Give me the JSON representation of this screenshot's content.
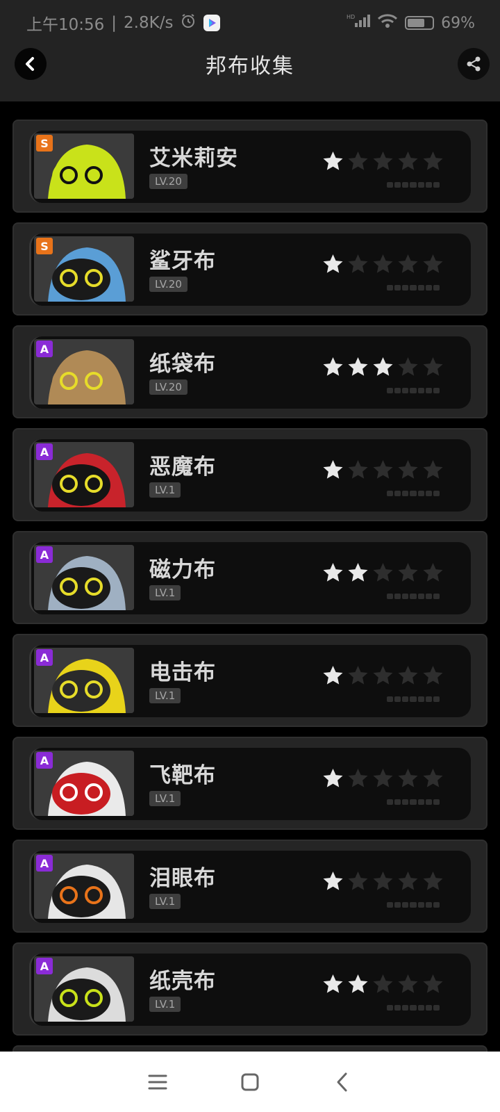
{
  "status_bar": {
    "time": "上午10:56",
    "speed": "2.8K/s",
    "network": "HD",
    "battery": "69%",
    "battery_fraction": 0.69
  },
  "header": {
    "title": "邦布收集"
  },
  "colors": {
    "background": "#000000",
    "bar": "#232323",
    "grade_s": "#e8731a",
    "grade_a": "#8a2bd6"
  },
  "items": [
    {
      "name": "艾米莉安",
      "grade": "S",
      "level": "LV.20",
      "stars": 1,
      "art": "lime"
    },
    {
      "name": "鲨牙布",
      "grade": "S",
      "level": "LV.20",
      "stars": 1,
      "art": "shark"
    },
    {
      "name": "纸袋布",
      "grade": "A",
      "level": "LV.20",
      "stars": 3,
      "art": "bag"
    },
    {
      "name": "恶魔布",
      "grade": "A",
      "level": "LV.1",
      "stars": 1,
      "art": "devil"
    },
    {
      "name": "磁力布",
      "grade": "A",
      "level": "LV.1",
      "stars": 2,
      "art": "magnet"
    },
    {
      "name": "电击布",
      "grade": "A",
      "level": "LV.1",
      "stars": 1,
      "art": "electric"
    },
    {
      "name": "飞靶布",
      "grade": "A",
      "level": "LV.1",
      "stars": 1,
      "art": "target"
    },
    {
      "name": "泪眼布",
      "grade": "A",
      "level": "LV.1",
      "stars": 1,
      "art": "tear"
    },
    {
      "name": "纸壳布",
      "grade": "A",
      "level": "LV.1",
      "stars": 2,
      "art": "carton"
    }
  ],
  "nav": {
    "icons": [
      "menu-icon",
      "home-square-icon",
      "back-chevron-icon"
    ]
  }
}
